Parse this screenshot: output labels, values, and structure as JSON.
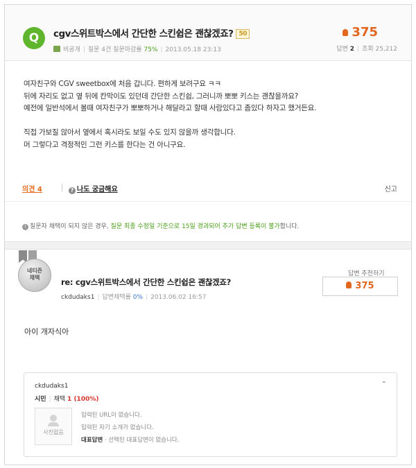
{
  "question": {
    "badge": "Q",
    "title": "cgv스위트박스에서 간단한 스킨쉽은 괜찮겠죠?",
    "nae_badge": "50",
    "meta": {
      "privacy": "비공개",
      "question_info": "질문 4건 질문마감률",
      "close_rate": "75%",
      "datetime": "2013.05.18 23:13"
    },
    "points": "375",
    "answers_label": "답변",
    "answers_count": "2",
    "views_label": "조회",
    "views_count": "25,212",
    "body": [
      "여자친구와 CGV sweetbox에 처음 갑니다. 편하게 보려구요 ㅋㅋ",
      "뒤에 자리도 없고 옆 뒤에 칸막이도 있던데 간단한 스킨쉽, 그러니까 뽀뽀 키스는 괜찮을까요?",
      "예전에 일반석에서 볼때 여자친구가 뽀뽀하거나 해달라고 할때 사람있다고 좀있다 하자고 했거든요.",
      "",
      "직접 가보질 않아서 옆에서 혹시라도 보일 수도 있지 않을까 생각합니다.",
      "머 그렇다고 격정적인 그런 키스를 한다는 건 아니구요."
    ]
  },
  "actions": {
    "opinion": "의견 4",
    "curious": "나도 궁금해요",
    "report": "신고"
  },
  "notice": {
    "prefix": "질문자 채택이 되지 않은 경우,",
    "highlight": "질문 최종 수정일 기준으로 15일 경과되어 추가 답변 등록이 불가",
    "suffix": "합니다."
  },
  "answer": {
    "medal_line1": "네티즌",
    "medal_line2": "채택",
    "title": "re: cgv스위트박스에서 간단한 스킨쉽은 괜찮겠죠?",
    "user": "ckdudaks1",
    "adopt_label": "답변채택률",
    "adopt_rate": "0%",
    "datetime": "2013.06.02 16:57",
    "recommend_label": "답변 추천하기",
    "recommend_points": "375",
    "text": "아이 개자식아"
  },
  "profile": {
    "name": "ckdudaks1",
    "rank": "시민",
    "adopt_label": "채택",
    "adopt_value": "1 (100%)",
    "photo_label": "사진없음",
    "url_text": "입력된 URL이 없습니다.",
    "intro_text": "입력된 자기 소개가 없습니다.",
    "rep_label": "대표답변",
    "rep_text": "· 선택된 대표답변이 없습니다."
  },
  "icons": {
    "chevron": "chevron-up-icon",
    "point_icon": "point-bag-icon"
  },
  "colors": {
    "accent_green": "#5fb52b",
    "points_orange": "#e2661e"
  }
}
